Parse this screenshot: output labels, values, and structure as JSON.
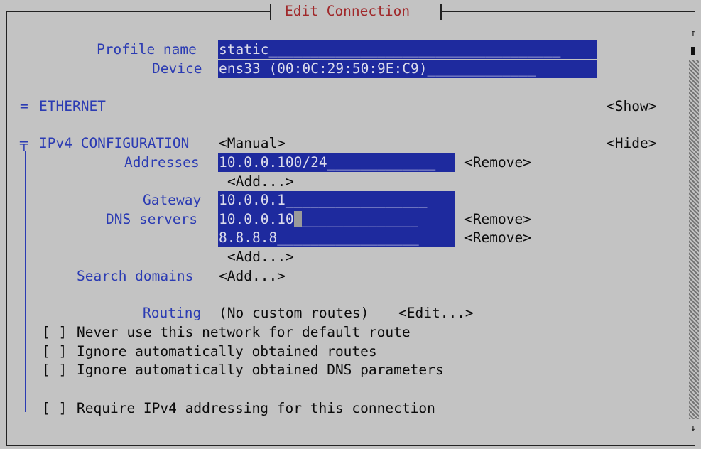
{
  "window": {
    "title": "Edit Connection"
  },
  "profile": {
    "label": "Profile name",
    "value": "static",
    "fill": "___________________________________"
  },
  "device": {
    "label": "Device",
    "value": "ens33 (00:0C:29:50:9E:C9)",
    "fill": "_____________"
  },
  "ethernet": {
    "marker": "=",
    "heading": "ETHERNET",
    "toggle": "<Show>"
  },
  "ipv4": {
    "marker": "╤",
    "heading": "IPv4 CONFIGURATION",
    "mode": "<Manual>",
    "toggle": "<Hide>",
    "addresses_label": "Addresses",
    "addresses": [
      {
        "value": "10.0.0.100/24",
        "fill": "_____________",
        "remove": "<Remove>"
      }
    ],
    "add_address": "<Add...>",
    "gateway_label": "Gateway",
    "gateway": {
      "value": "10.0.0.1",
      "fill": "_________________"
    },
    "dns_label": "DNS servers",
    "dns": [
      {
        "value": "10.0.0.10",
        "fill": "______________",
        "remove": "<Remove>"
      },
      {
        "value": "8.8.8.8",
        "fill": "_________________",
        "remove": "<Remove>"
      }
    ],
    "add_dns": "<Add...>",
    "search_label": "Search domains",
    "add_search": "<Add...>",
    "routing_label": "Routing",
    "routing_value": "(No custom routes)",
    "routing_edit": "<Edit...>",
    "checkboxes": [
      {
        "box": "[ ]",
        "label": "Never use this network for default route"
      },
      {
        "box": "[ ]",
        "label": "Ignore automatically obtained routes"
      },
      {
        "box": "[ ]",
        "label": "Ignore automatically obtained DNS parameters"
      },
      {
        "box": "[ ]",
        "label": "Require IPv4 addressing for this connection"
      }
    ]
  },
  "scrollbar": {
    "up": "↑",
    "down": "↓"
  },
  "colors": {
    "background": "#c3c3c3",
    "field": "#1e2a9e",
    "label": "#2b3bb3",
    "title": "#a0282a"
  }
}
